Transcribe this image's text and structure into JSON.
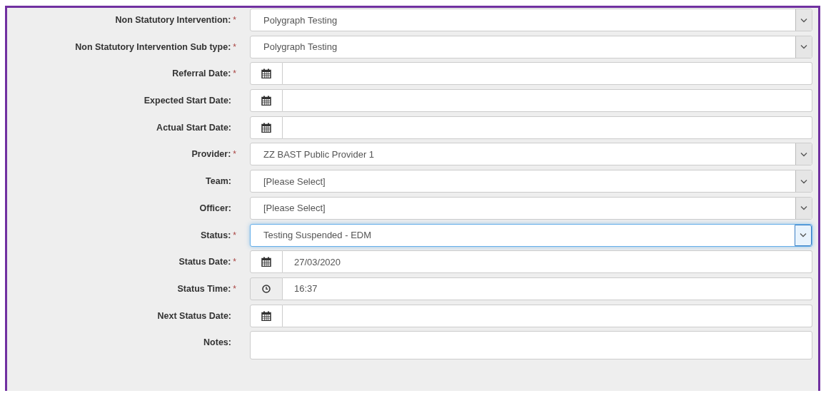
{
  "fields": [
    {
      "label": "Non Statutory Intervention:",
      "required": true,
      "kind": "select",
      "value": "Polygraph Testing",
      "focused": false
    },
    {
      "label": "Non Statutory Intervention Sub type:",
      "required": true,
      "kind": "select",
      "value": "Polygraph Testing",
      "focused": false
    },
    {
      "label": "Referral Date:",
      "required": true,
      "kind": "date"
    },
    {
      "label": "Expected Start Date:",
      "required": false,
      "kind": "date"
    },
    {
      "label": "Actual Start Date:",
      "required": false,
      "kind": "date"
    },
    {
      "label": "Provider:",
      "required": true,
      "kind": "select",
      "value": "ZZ BAST Public Provider 1",
      "focused": false
    },
    {
      "label": "Team:",
      "required": false,
      "kind": "select",
      "value": "[Please Select]",
      "focused": false
    },
    {
      "label": "Officer:",
      "required": false,
      "kind": "select",
      "value": "[Please Select]",
      "focused": false
    },
    {
      "label": "Status:",
      "required": true,
      "kind": "select",
      "value": "Testing Suspended - EDM",
      "focused": true
    },
    {
      "label": "Status Date:",
      "required": true,
      "kind": "date",
      "value": "27/03/2020"
    },
    {
      "label": "Status Time:",
      "required": true,
      "kind": "time",
      "value": "16:37"
    },
    {
      "label": "Next Status Date:",
      "required": false,
      "kind": "date"
    },
    {
      "label": "Notes:",
      "required": false,
      "kind": "text"
    }
  ],
  "required_mark": "*"
}
